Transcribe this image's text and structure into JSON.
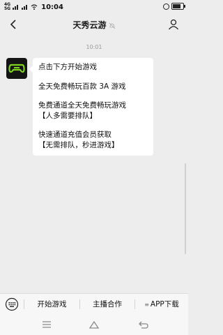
{
  "status_bar": {
    "signal_top": "4G",
    "signal_bottom": "5G",
    "time": "10:04",
    "battery_level": 0.8
  },
  "header": {
    "title": "天秀云游"
  },
  "chat": {
    "timestamp": "10:01",
    "message_lines": [
      "点击下方开始游戏",
      "",
      "全天免费畅玩百款 3A 游戏",
      "",
      "免费通道全天免费畅玩游戏",
      "【人多需要排队】",
      "",
      "快速通道充值会员获取",
      "【无需排队，秒进游戏】"
    ]
  },
  "bottom_menu": {
    "items": [
      "开始游戏",
      "主播合作",
      "APP下载"
    ],
    "app_menu_prefix": "≡"
  },
  "icons": {
    "back": "chevron-left-icon",
    "mute": "bell-mute-icon",
    "profile": "person-icon",
    "keyboard": "keyboard-icon",
    "nav_menu": "menu-icon",
    "nav_home": "home-icon",
    "nav_back": "back-icon"
  },
  "colors": {
    "background": "#ededed",
    "bubble": "#ffffff",
    "avatar_bg": "#141414",
    "avatar_accent": "#7ed321"
  }
}
